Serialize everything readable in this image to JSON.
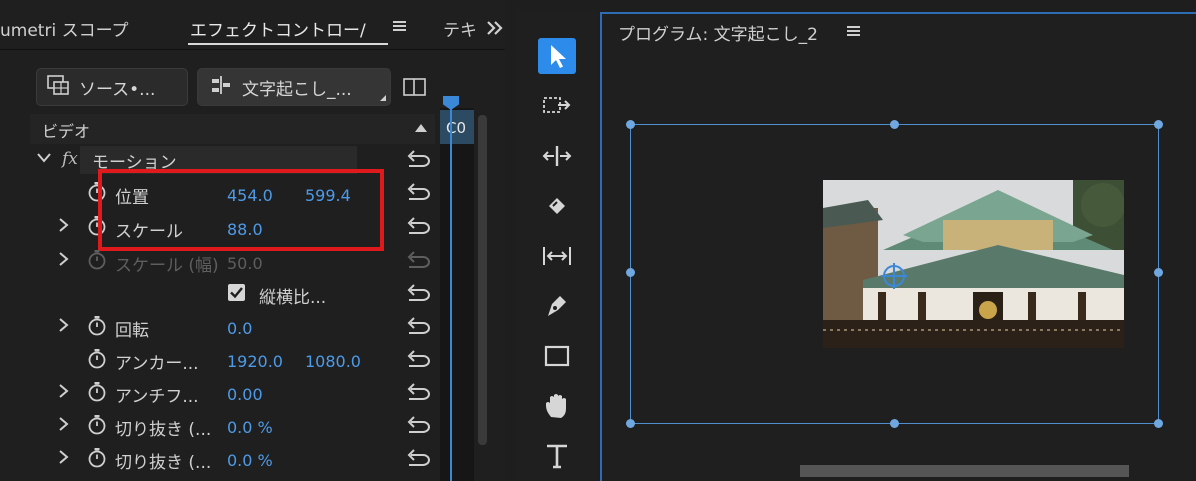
{
  "effect_controls": {
    "tabs": {
      "lumetri": "umetri スコープ",
      "effect": "エフェクトコントロー/",
      "text": "テキ"
    },
    "source_button": "ソース•...",
    "clip_button": "文字起こし_...",
    "section_video": "ビデオ",
    "timeline_label": "C0",
    "motion_label": "モーション",
    "fx_label": "fx",
    "properties": [
      {
        "label": "位置",
        "value1": "454.0",
        "value2": "599.4"
      },
      {
        "label": "スケール",
        "value1": "88.0"
      },
      {
        "label": "スケール (幅)",
        "value1": "50.0"
      },
      {
        "label": "縦横比..."
      },
      {
        "label": "回転",
        "value1": "0.0"
      },
      {
        "label": "アンカー...",
        "value1": "1920.0",
        "value2": "1080.0"
      },
      {
        "label": "アンチフ...",
        "value1": "0.00"
      },
      {
        "label": "切り抜き (...",
        "value1": "0.0 %"
      },
      {
        "label": "切り抜き (...",
        "value1": "0.0 %"
      }
    ],
    "highlight_color": "#e0191c"
  },
  "program_monitor": {
    "title": "プログラム: 文字起こし_2"
  },
  "tools": [
    "selection-tool",
    "track-select-tool",
    "ripple-edit-tool",
    "razor-tool",
    "slip-tool",
    "pen-tool",
    "rectangle-tool",
    "hand-tool",
    "type-tool"
  ],
  "colors": {
    "accent": "#2d8ceb",
    "value_blue": "#4d9be8",
    "panel_bg": "#1f1f1f"
  }
}
